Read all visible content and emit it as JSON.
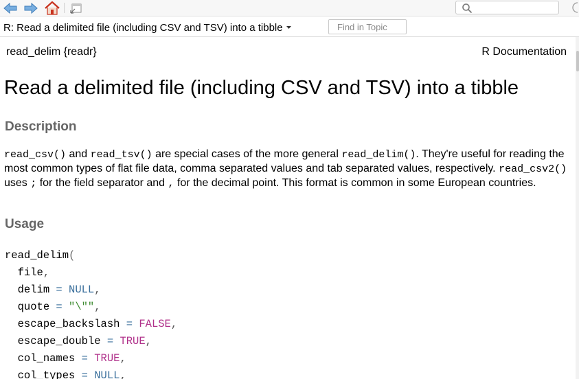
{
  "toolbar": {
    "search": {
      "placeholder": "",
      "value": ""
    }
  },
  "topic": {
    "current": "R: Read a delimited file (including CSV and TSV) into a tibble",
    "find_placeholder": "Find in Topic"
  },
  "doc": {
    "header_left": "read_delim {readr}",
    "header_right": "R Documentation",
    "title": "Read a delimited file (including CSV and TSV) into a tibble",
    "description_heading": "Description",
    "description": {
      "fn1": "read_csv()",
      "t1": " and ",
      "fn2": "read_tsv()",
      "t2": " are special cases of the more general ",
      "fn3": "read_delim()",
      "t3": ". They're useful for reading the most common types of flat file data, comma separated values and tab separated values, respectively. ",
      "fn4": "read_csv2()",
      "t4": " uses ",
      "sym1": ";",
      "t5": " for the field separator and ",
      "sym2": ",",
      "t6": " for the decimal point. This format is common in some European countries."
    },
    "usage_heading": "Usage",
    "usage": {
      "call": "read_delim",
      "open": "(",
      "lines": [
        {
          "name": "file",
          "op": "",
          "value": "",
          "kind": "",
          "sep": ","
        },
        {
          "name": "delim",
          "op": " = ",
          "value": "NULL",
          "kind": "op",
          "sep": ","
        },
        {
          "name": "quote",
          "op": " = ",
          "value": "\"\\\"\"",
          "kind": "str",
          "sep": ","
        },
        {
          "name": "escape_backslash",
          "op": " = ",
          "value": "FALSE",
          "kind": "kw",
          "sep": ","
        },
        {
          "name": "escape_double",
          "op": " = ",
          "value": "TRUE",
          "kind": "kw",
          "sep": ","
        },
        {
          "name": "col_names",
          "op": " = ",
          "value": "TRUE",
          "kind": "kw",
          "sep": ","
        },
        {
          "name": "col_types",
          "op": " = ",
          "value": "NULL",
          "kind": "op",
          "sep": ","
        }
      ]
    }
  },
  "colors": {
    "heading_gray": "#666666",
    "home_red": "#c8321e",
    "nav_blue": "#4a90c8",
    "keyword_magenta": "#b0308a",
    "string_green": "#3c8a2f"
  },
  "icons": [
    "back-arrow-icon",
    "forward-arrow-icon",
    "home-icon",
    "popout-window-icon",
    "search-icon",
    "refresh-icon",
    "caret-down-icon"
  ]
}
